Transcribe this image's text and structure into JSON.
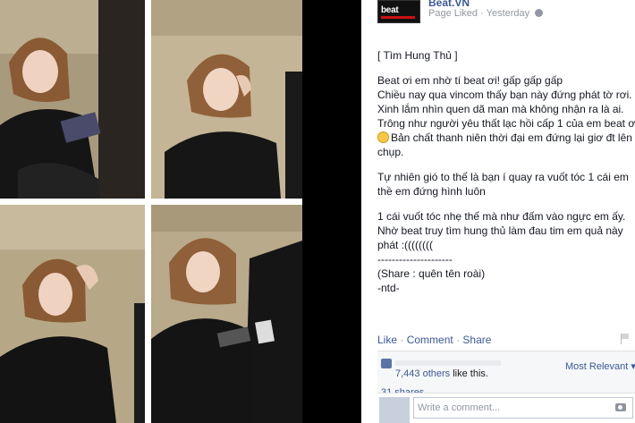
{
  "page": {
    "name": "Beat.VN",
    "logo_text": "beat",
    "status": "Page Liked",
    "separator": "·",
    "time": "Yesterday",
    "audience_icon": "globe-icon"
  },
  "post": {
    "title": "[ Tìm Hung Thủ ]",
    "lines_a": [
      "Beat ơi em nhờ tí beat ơi! gấp gấp gấp",
      "Chiều nay qua vincom thấy bạn này đứng phát tờ rơi.",
      "Xinh lắm nhìn quen dã man mà không nhận ra là ai.",
      "Trông như người yêu thất lạc hồi cấp 1 của em beat ơi"
    ],
    "emoji_line": "Bản chất thanh niên thời đại em đứng lại giơ đt lên",
    "line_chup": "chụp.",
    "lines_b": [
      "Tự nhiên gió to thế là bạn í quay ra vuốt tóc 1 cái em",
      "thề em đứng hình luôn"
    ],
    "lines_c": [
      "1 cái vuốt tóc nhẹ thế mà như đấm vào ngực em ấy.",
      "Nhờ beat truy tìm hung thủ làm đau tim em quả này",
      "phát :(((((((("
    ],
    "divider": "---------------------",
    "share_note": "(Share : quên tên roài)",
    "signature": "-ntd-",
    "emoji_icon": "crying-face-icon"
  },
  "actions": {
    "like": "Like",
    "comment": "Comment",
    "share": "Share",
    "sep": "·"
  },
  "ufi": {
    "likes_count": "7,443 others",
    "likes_suffix": " like this.",
    "sort": "Most Relevant",
    "shares": "31 shares",
    "comment_placeholder": "Write a comment..."
  },
  "colors": {
    "link": "#3b5998",
    "meta": "#9197a3",
    "overlay": "#000000"
  }
}
